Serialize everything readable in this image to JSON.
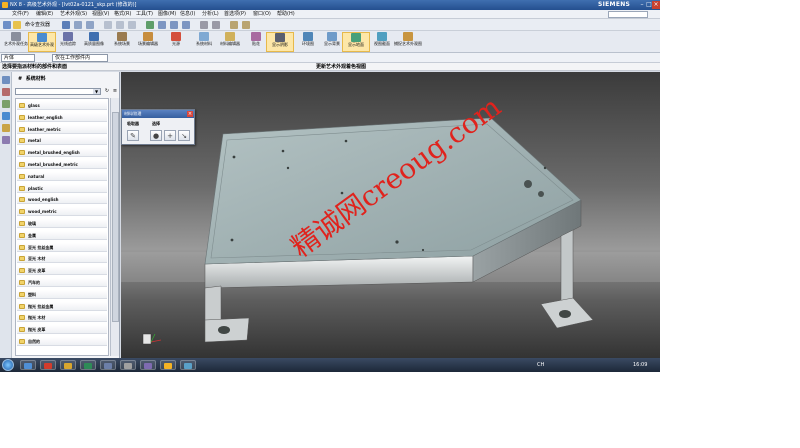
{
  "window": {
    "title": "NX 8 - 高级艺术外观 - [lvt02a-0121_skp.prt (修改的)]",
    "brand": "SIEMENS",
    "controls": [
      "–",
      "□",
      "×"
    ]
  },
  "menubar": {
    "items": [
      "文件(F)",
      "编辑(E)",
      "艺术外观(S)",
      "视图(V)",
      "格式(R)",
      "工具(T)",
      "图像(M)",
      "信息(I)",
      "分析(L)",
      "首选项(P)",
      "窗口(O)",
      "帮助(H)"
    ]
  },
  "toolbar1": {
    "command_finder": "命令查找器"
  },
  "toolbar2": {
    "tools": [
      {
        "label": "艺术外观任务",
        "icon": "task-icon",
        "active": false
      },
      {
        "label": "高级艺术外观",
        "icon": "advanced-studio-icon",
        "active": true
      },
      {
        "label": "光线追踪",
        "icon": "raytrace-icon",
        "active": false
      },
      {
        "label": "高质量图像",
        "icon": "image-icon",
        "active": false
      },
      {
        "label": "系统场景",
        "icon": "scene-icon",
        "active": false
      },
      {
        "label": "场景编辑器",
        "icon": "scene-editor-icon",
        "active": false
      },
      {
        "label": "光源",
        "icon": "light-icon",
        "active": false
      },
      {
        "label": "系统材料",
        "icon": "system-material-icon",
        "active": false
      },
      {
        "label": "材料编辑器",
        "icon": "material-editor-icon",
        "active": false
      },
      {
        "label": "贴花",
        "icon": "decal-icon",
        "active": false
      },
      {
        "label": "显示阴影",
        "icon": "shadow-icon",
        "active": true
      },
      {
        "label": "环境图",
        "icon": "environment-icon",
        "active": false
      },
      {
        "label": "显示背景",
        "icon": "background-icon",
        "active": false
      },
      {
        "label": "显示地面",
        "icon": "floor-icon",
        "active": true
      },
      {
        "label": "视图截面",
        "icon": "section-icon",
        "active": false
      },
      {
        "label": "捕捉艺术外观图像",
        "icon": "capture-icon",
        "active": false
      }
    ]
  },
  "selection": {
    "filter": "片体",
    "scope": "仅在工作部件内"
  },
  "cue": {
    "left": "选择要指派材料的部件和表面",
    "center": "更新艺术外观着色视图"
  },
  "navigator": {
    "heading": "系统材料",
    "materials": [
      "glass",
      "leather_english",
      "leather_metric",
      "metal",
      "metal_brushed_english",
      "metal_brushed_metric",
      "natural",
      "plastic",
      "wood_english",
      "wood_metric",
      "玻璃",
      "金属",
      "亚光 拉丝金属",
      "亚光 木材",
      "亚光 皮革",
      "汽车的",
      "塑料",
      "抛光 拉丝金属",
      "抛光 木材",
      "抛光 皮革",
      "自然的"
    ]
  },
  "dialog": {
    "title": "材料/纹理",
    "tabs": [
      "吸取器",
      "选择"
    ]
  },
  "watermark": "精诚网creoug.com",
  "taskbar": {
    "tray": "CH",
    "clock": "16:09"
  }
}
